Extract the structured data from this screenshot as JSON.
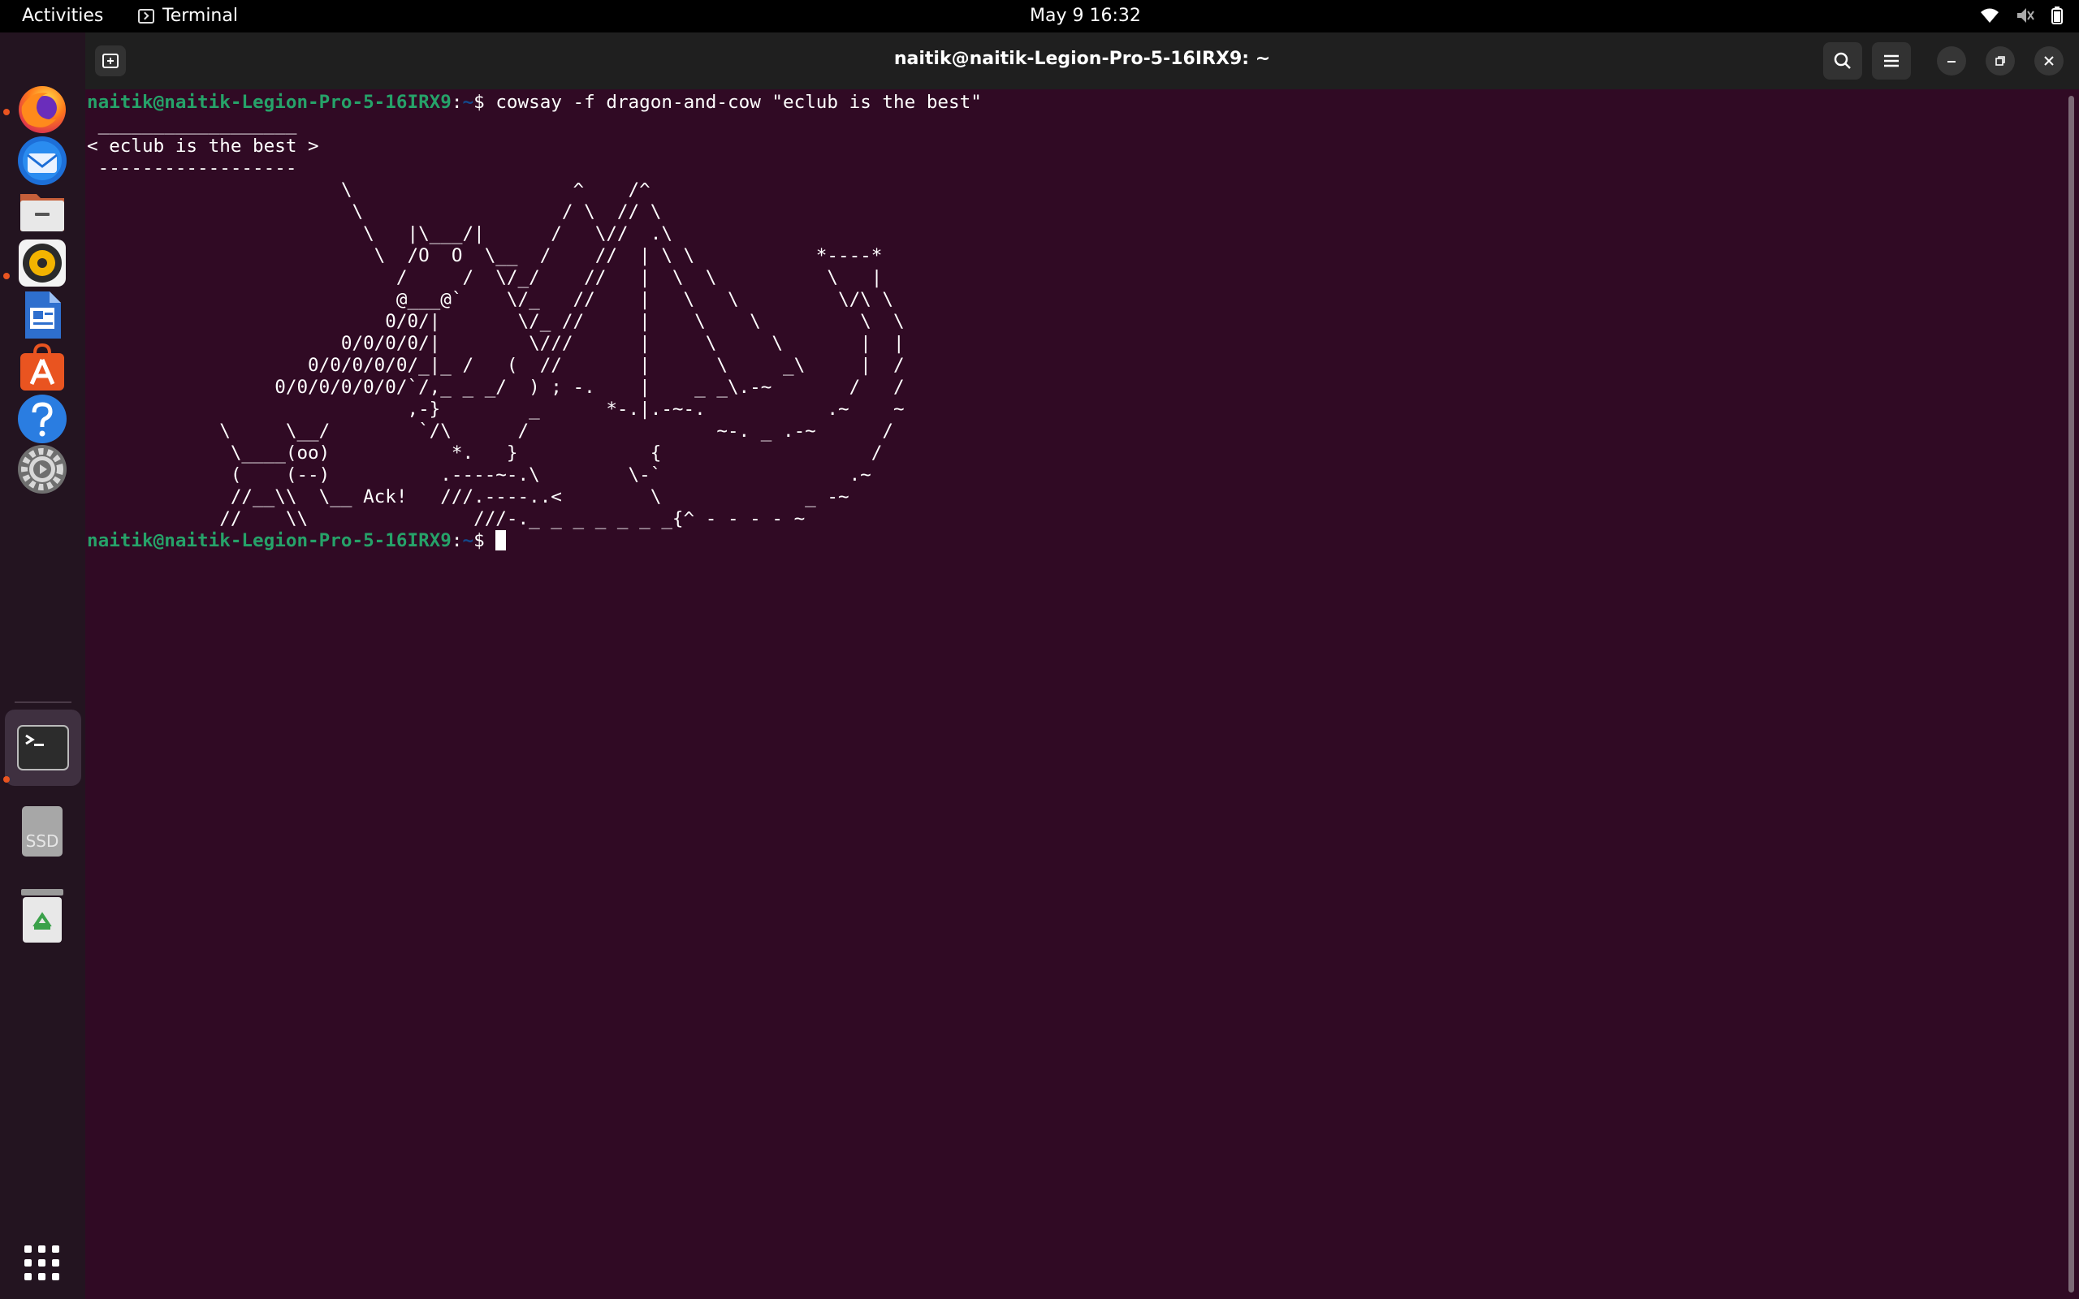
{
  "topbar": {
    "activities": "Activities",
    "app_name": "Terminal",
    "clock": "May 9  16:32",
    "status_icons": [
      "wifi-icon",
      "volume-muted-icon",
      "battery-icon"
    ]
  },
  "dock": {
    "items": [
      {
        "name": "firefox",
        "running": true
      },
      {
        "name": "thunderbird",
        "running": false
      },
      {
        "name": "files",
        "running": true
      },
      {
        "name": "rhythmbox",
        "running": false
      },
      {
        "name": "libreoffice-writer",
        "running": false
      },
      {
        "name": "app-center",
        "running": false
      },
      {
        "name": "help",
        "running": false
      },
      {
        "name": "settings",
        "running": false
      },
      {
        "name": "terminal",
        "running": true,
        "active": true
      },
      {
        "name": "ssd-drive",
        "label": "SSD"
      },
      {
        "name": "trash"
      }
    ],
    "show_apps": "show-apps-icon"
  },
  "window": {
    "title": "naitik@naitik-Legion-Pro-5-16IRX9: ~"
  },
  "terminal": {
    "prompt_user": "naitik@naitik-Legion-Pro-5-16IRX9",
    "prompt_sep": ":",
    "prompt_path": "~",
    "prompt_dollar": "$ ",
    "command": "cowsay -f dragon-and-cow \"eclub is the best\"",
    "output": " __________________\n< eclub is the best >\n ------------------\n                       \\                    ^    /^\n                        \\                  / \\  // \\\n                         \\   |\\___/|      /   \\//  .\\\n                          \\  /O  O  \\__  /    //  | \\ \\           *----*\n                            /     /  \\/_/    //   |  \\  \\          \\   |\n                            @___@`    \\/_   //    |   \\   \\         \\/\\ \\\n                           0/0/|       \\/_ //     |    \\    \\         \\  \\\n                       0/0/0/0/|        \\///      |     \\     \\       |  |\n                    0/0/0/0/0/_|_ /   (  //       |      \\     _\\     |  /\n                 0/0/0/0/0/0/`/,_ _ _/  ) ; -.    |    _ _\\.-~       /   /\n                             ,-}        _      *-.|.-~-.           .~    ~\n            \\     \\__/        `/\\      /                 ~-. _ .-~      /\n             \\____(oo)           *.   }            {                   /\n             (    (--)          .----~-.\\        \\-`                 .~\n             //__\\\\  \\__ Ack!   ///.----..<        \\             _ -~\n            //    \\\\               ///-._ _ _ _ _ _ _{^ - - - - ~"
  },
  "colors": {
    "terminal_bg": "#300a24",
    "prompt_user": "#26a269",
    "prompt_path": "#12488b",
    "titlebar_bg": "#1f1f1f",
    "accent": "#e95420"
  }
}
